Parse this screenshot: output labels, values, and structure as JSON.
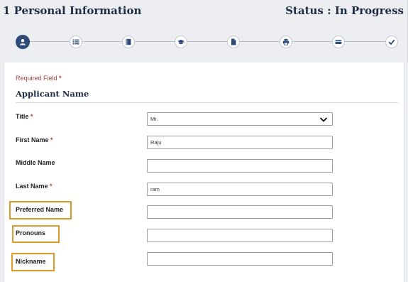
{
  "header": {
    "title": "1 Personal Information",
    "status": "Status : In Progress"
  },
  "stepper": {
    "steps": [
      {
        "icon": "user-icon",
        "active": true
      },
      {
        "icon": "list-icon",
        "active": false
      },
      {
        "icon": "book-icon",
        "active": false
      },
      {
        "icon": "graduation-cap-icon",
        "active": false
      },
      {
        "icon": "document-icon",
        "active": false
      },
      {
        "icon": "printer-icon",
        "active": false
      },
      {
        "icon": "payment-card-icon",
        "active": false
      },
      {
        "icon": "check-icon",
        "active": false
      }
    ]
  },
  "form": {
    "required_note": "Required Field",
    "required_star": "*",
    "section_title": "Applicant Name",
    "fields": {
      "title": {
        "label": "Title",
        "required": "*",
        "value": "Mr."
      },
      "first_name": {
        "label": "First Name",
        "required": "*",
        "value": "Raju"
      },
      "middle_name": {
        "label": "Middle Name",
        "value": ""
      },
      "last_name": {
        "label": "Last Name",
        "required": "*",
        "value": "ram"
      },
      "preferred_name": {
        "label": "Preferred Name",
        "value": ""
      },
      "pronouns": {
        "label": "Pronouns",
        "value": ""
      },
      "nickname": {
        "label": "Nickname",
        "value": ""
      }
    }
  },
  "colors": {
    "highlight": "#e09a2a",
    "active_step": "#2e4b7a",
    "required": "#c0392b"
  }
}
